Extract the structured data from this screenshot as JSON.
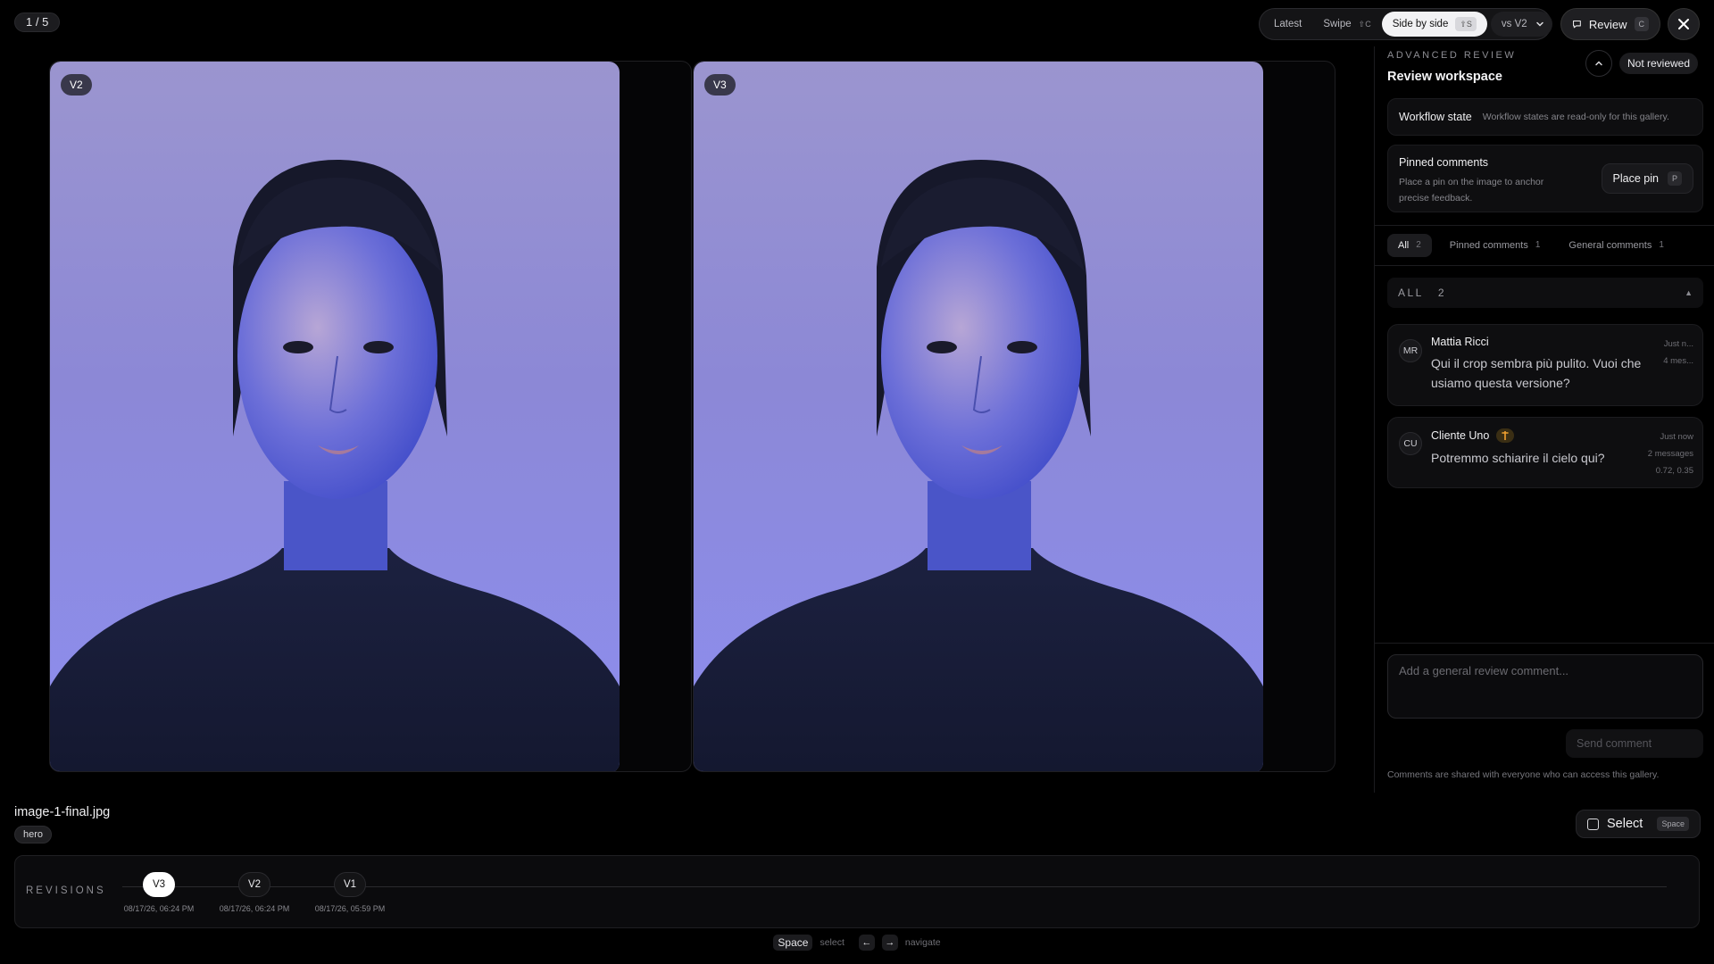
{
  "counter": "1 / 5",
  "modes": [
    {
      "label": "Latest",
      "kbd": ""
    },
    {
      "label": "Swipe",
      "kbd": "⇧C"
    },
    {
      "label": "Side by side",
      "kbd": "⇧S"
    }
  ],
  "compare_select": "vs V2",
  "review_button": {
    "label": "Review",
    "kbd": "C"
  },
  "panes": [
    {
      "badge": "V2"
    },
    {
      "badge": "V3"
    }
  ],
  "panel": {
    "eyebrow": "ADVANCED REVIEW",
    "title": "Review workspace",
    "status": "Not reviewed",
    "workflow": {
      "title": "Workflow state",
      "note": "Workflow states are read-only for this gallery."
    },
    "pinned": {
      "title": "Pinned comments",
      "desc": "Place a pin on the image to anchor precise feedback.",
      "button": "Place pin",
      "kbd": "P"
    },
    "tabs": [
      {
        "label": "All",
        "count": "2"
      },
      {
        "label": "Pinned comments",
        "count": "1"
      },
      {
        "label": "General comments",
        "count": "1"
      }
    ],
    "section": {
      "label": "ALL",
      "count": "2"
    },
    "comments": [
      {
        "initials": "MR",
        "author": "Mattia Ricci",
        "text": "Qui il crop sembra più pulito. Vuoi che usiamo questa versione?",
        "meta1": "Just n...",
        "meta2": "4 mes...",
        "meta3": ""
      },
      {
        "initials": "CU",
        "author": "Cliente Uno",
        "text": "Potremmo schiarire il cielo qui?",
        "meta1": "Just now",
        "meta2": "2 messages",
        "meta3": "0.72, 0.35"
      }
    ],
    "composer_placeholder": "Add a general review comment...",
    "send_button": "Send comment",
    "share_note": "Comments are shared with everyone who can access this gallery."
  },
  "file": {
    "name": "image-1-final.jpg",
    "tag": "hero"
  },
  "select_button": {
    "label": "Select",
    "kbd": "Space"
  },
  "revisions": {
    "label": "REVISIONS",
    "items": [
      {
        "label": "V3",
        "date": "08/17/26, 06:24 PM",
        "active": true
      },
      {
        "label": "V2",
        "date": "08/17/26, 06:24 PM",
        "active": false
      },
      {
        "label": "V1",
        "date": "08/17/26, 05:59 PM",
        "active": false
      }
    ]
  },
  "hints": {
    "space_key": "Space",
    "space_action": "select",
    "nav_action": "navigate"
  },
  "colors": {
    "accent": "#f2f2f4",
    "backdrop": "#8d8ef0",
    "pin": "#f0a030"
  }
}
